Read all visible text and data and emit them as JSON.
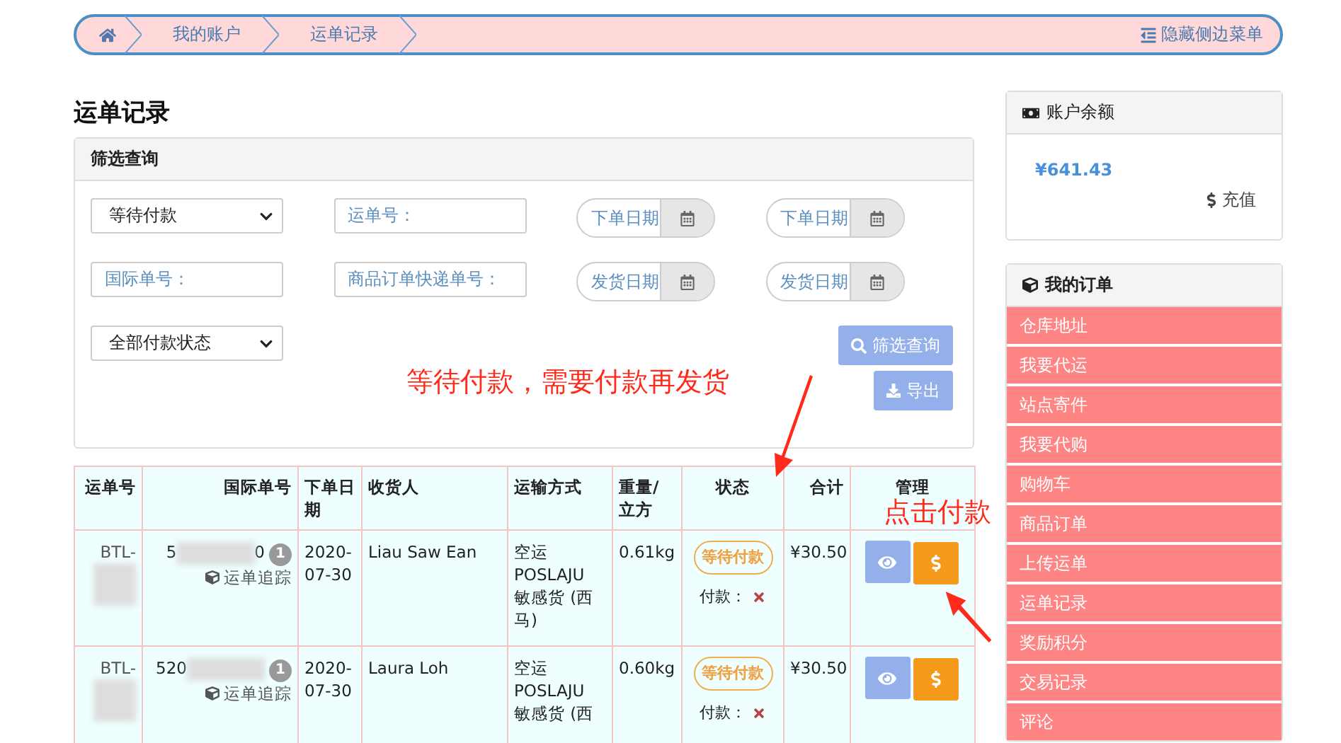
{
  "breadcrumb": {
    "items": [
      "我的账户",
      "运单记录"
    ],
    "toggle": "隐藏侧边菜单"
  },
  "page_title": "运单记录",
  "filter": {
    "title": "筛选查询",
    "fields": [
      {
        "kind": "select",
        "value": "等待付款"
      },
      {
        "kind": "text",
        "placeholder": "运单号："
      },
      {
        "kind": "date",
        "placeholder": "下单日期"
      },
      {
        "kind": "date",
        "placeholder": "下单日期"
      },
      {
        "kind": "text",
        "placeholder": "国际单号："
      },
      {
        "kind": "text",
        "placeholder": "商品订单快递单号："
      },
      {
        "kind": "date",
        "placeholder": "发货日期"
      },
      {
        "kind": "date",
        "placeholder": "发货日期"
      },
      {
        "kind": "select",
        "value": "全部付款状态"
      }
    ],
    "search_button": "筛选查询",
    "export_button": "导出"
  },
  "table": {
    "columns": [
      "运单号",
      "国际单号",
      "下单日期",
      "收货人",
      "运输方式",
      "重量/立方",
      "状态",
      "合计",
      "管理"
    ],
    "rows": [
      {
        "waybill": "BTL-",
        "intl_start": "5",
        "intl_end": "0",
        "count": "1",
        "track": "运单追踪",
        "date": "2020-07-30",
        "recipient": "Liau Saw Ean",
        "shipping": "空运 POSLAJU 敏感货 (西马)",
        "weight": "0.61kg",
        "status": "等待付款",
        "paid_label": "付款：",
        "paid": false,
        "total": "¥30.50"
      },
      {
        "waybill": "BTL-",
        "intl_start": "520",
        "intl_end": "",
        "count": "1",
        "track": "运单追踪",
        "date": "2020-07-30",
        "recipient": "Laura Loh",
        "shipping": "空运 POSLAJU 敏感货 (西",
        "weight": "0.60kg",
        "status": "等待付款",
        "paid_label": "付款：",
        "paid": false,
        "total": "¥30.50"
      }
    ]
  },
  "annotations": [
    {
      "text": "等待付款，需要付款再发货"
    },
    {
      "text": "点击付款"
    }
  ],
  "balance": {
    "title": "账户余额",
    "amount": "¥641.43",
    "recharge": "充值"
  },
  "orders_menu": {
    "title": "我的订单",
    "items": [
      {
        "label": "仓库地址",
        "selected": false
      },
      {
        "label": "我要代运",
        "selected": false
      },
      {
        "label": "站点寄件",
        "selected": false
      },
      {
        "label": "我要代购",
        "selected": false
      },
      {
        "label": "购物车",
        "selected": false
      },
      {
        "label": "商品订单",
        "selected": false
      },
      {
        "label": "上传运单",
        "selected": false
      },
      {
        "label": "运单记录",
        "selected": false
      },
      {
        "label": "奖励积分",
        "selected": false
      },
      {
        "label": "交易记录",
        "selected": false
      },
      {
        "label": "评论",
        "selected": false
      }
    ]
  }
}
